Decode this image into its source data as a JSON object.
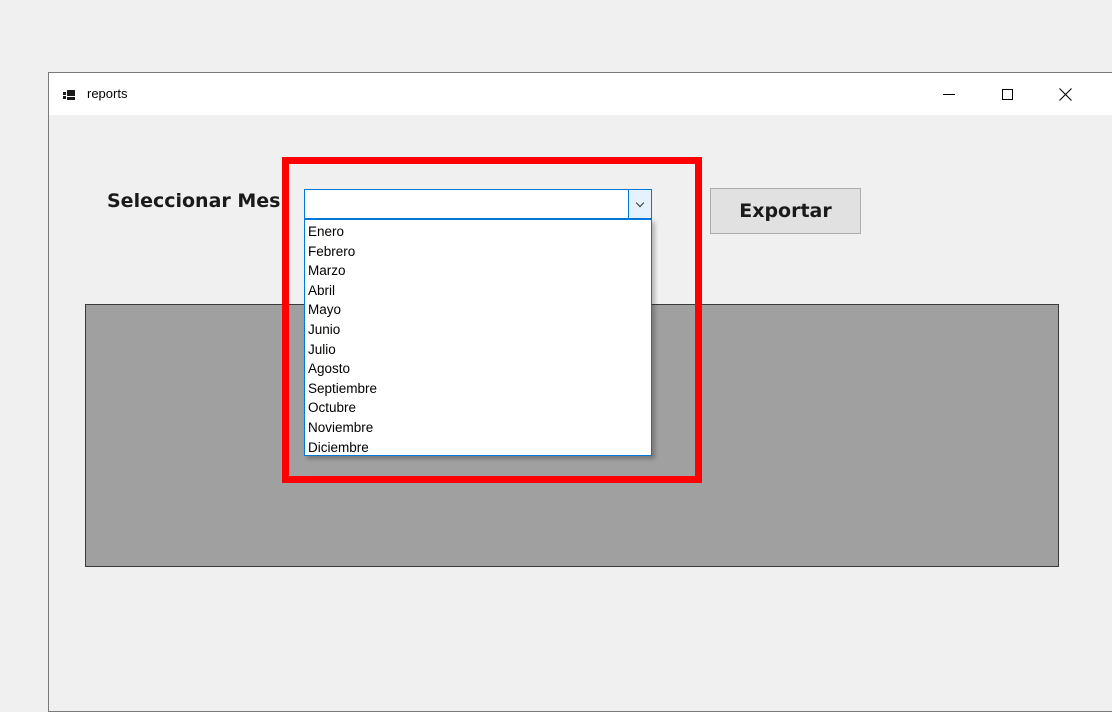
{
  "window": {
    "title": "reports",
    "controls": [
      "minimize",
      "maximize",
      "close"
    ],
    "icon": "app-form-icon"
  },
  "form": {
    "month_label": "Seleccionar Mes",
    "month_select_value": "",
    "export_button": "Exportar"
  },
  "dropdown": {
    "options": [
      "Enero",
      "Febrero",
      "Marzo",
      "Abril",
      "Mayo",
      "Junio",
      "Julio",
      "Agosto",
      "Septiembre",
      "Octubre",
      "Noviembre",
      "Diciembre"
    ]
  },
  "colors": {
    "highlight": "#ff0000",
    "focus_border": "#0078d7",
    "panel": "#a0a0a0",
    "background": "#f0f0f0"
  }
}
